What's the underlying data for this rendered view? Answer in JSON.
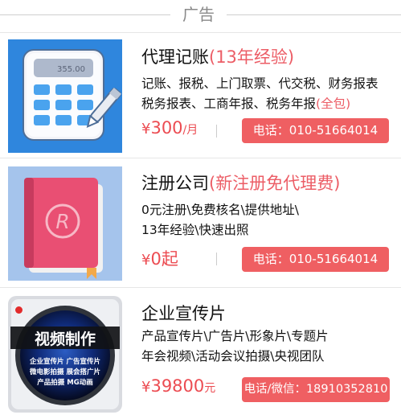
{
  "header": {
    "title": "广告"
  },
  "ads": [
    {
      "title": "代理记账",
      "title_highlight": "(13年经验)",
      "desc_line1": "记账、报税、上门取票、代交税、财务报表",
      "desc_line2": "税务报表、工商年报、税务年报",
      "desc_line2_highlight": "(全包)",
      "price_currency": "¥",
      "price_value": "300",
      "price_unit": "/月",
      "button_label": "电话：010-51664014",
      "calculator_display": "355.00"
    },
    {
      "title": "注册公司",
      "title_highlight": "(新注册免代理费)",
      "desc_line1": "0元注册\\免费核名\\提供地址\\",
      "desc_line2": "13年经验\\快速出照",
      "price_currency": "¥",
      "price_value": "0起",
      "button_label": "电话：010-51664014"
    },
    {
      "title": "企业宣传片",
      "desc_line1": "产品宣传片\\广告片\\形象片\\专题片",
      "desc_line2": "年会视频\\活动会议拍摄\\央视团队",
      "price_currency": "¥",
      "price_value": "39800",
      "price_unit": "元",
      "button_label": "电话/微信：18910352810",
      "thumb_title": "视频制作",
      "thumb_rows": [
        "企业宣传片  广告宣传片",
        "微电影拍摄  展会搭广片",
        "产品拍摄  MG动画"
      ]
    }
  ],
  "colors": {
    "accent": "#ec5d66",
    "button": "#ef5f62"
  }
}
